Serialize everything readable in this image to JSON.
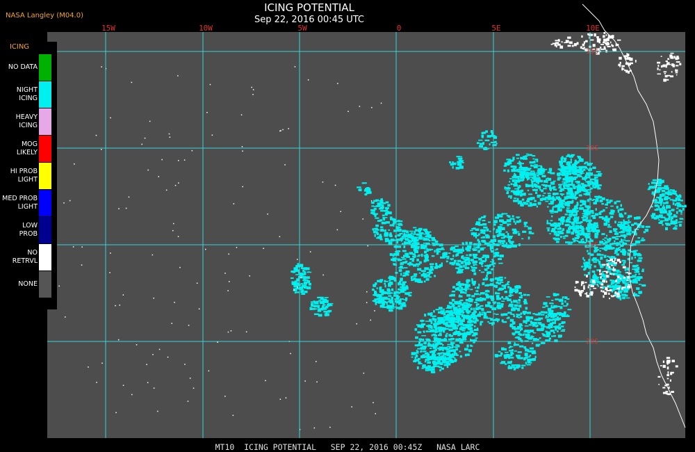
{
  "header": {
    "source": "NASA Langley (M04.0)",
    "title": "ICING POTENTIAL",
    "subtitle": "Sep 22, 2016 00:45 UTC"
  },
  "map": {
    "background_color": "#4d4d4d",
    "gridline_color": "#33d6d6",
    "coast_color": "#ffffff",
    "cloud_color": "#00f0f0",
    "longitude_labels": [
      "15W",
      "10W",
      "5W",
      "0",
      "5E",
      "10E"
    ],
    "latitude_labels": [
      "35S",
      "30S",
      "25S",
      "20S"
    ]
  },
  "legend": {
    "heading": "ICING",
    "items": [
      {
        "label": "NO DATA",
        "color": "#00b000"
      },
      {
        "label": "NIGHT\nICING",
        "color": "#00f0f0"
      },
      {
        "label": "HEAVY\nICING",
        "color": "#e6a8e6"
      },
      {
        "label": "MOG\nLIKELY",
        "color": "#ff0000"
      },
      {
        "label": "HI PROB\nLIGHT",
        "color": "#ffff00"
      },
      {
        "label": "MED PROB\nLIGHT",
        "color": "#0000ff"
      },
      {
        "label": "LOW\nPROB",
        "color": "#000090"
      },
      {
        "label": "NO\nRETRVL",
        "color": "#ffffff"
      },
      {
        "label": "NONE",
        "color": "#555555"
      }
    ]
  },
  "footer": {
    "caption": "MT10  ICING POTENTIAL   SEP 22, 2016 00:45Z   NASA LARC"
  }
}
